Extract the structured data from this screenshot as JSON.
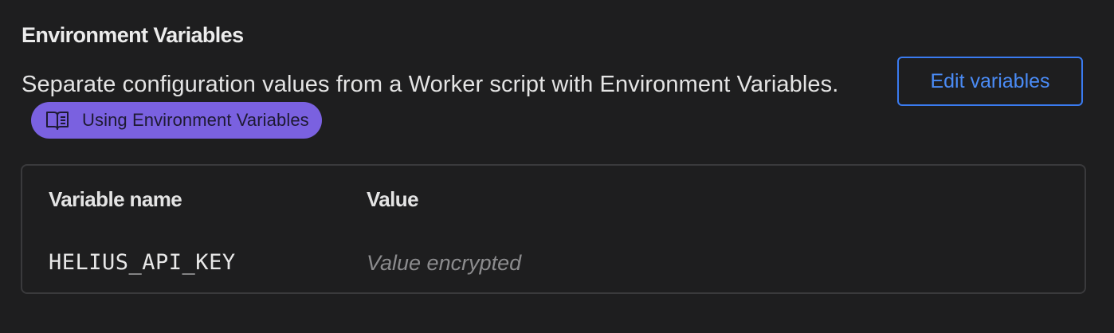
{
  "section": {
    "title": "Environment Variables",
    "description": "Separate configuration values from a Worker script with Environment Variables.",
    "docs_link": {
      "label": "Using Environment Variables",
      "icon": "book-icon",
      "color": "#7a61e0"
    },
    "edit_button_label": "Edit variables",
    "accent_color": "#3a7bf0"
  },
  "table": {
    "columns": [
      "Variable name",
      "Value"
    ],
    "rows": [
      {
        "name": "HELIUS_API_KEY",
        "value": "Value encrypted"
      }
    ]
  }
}
